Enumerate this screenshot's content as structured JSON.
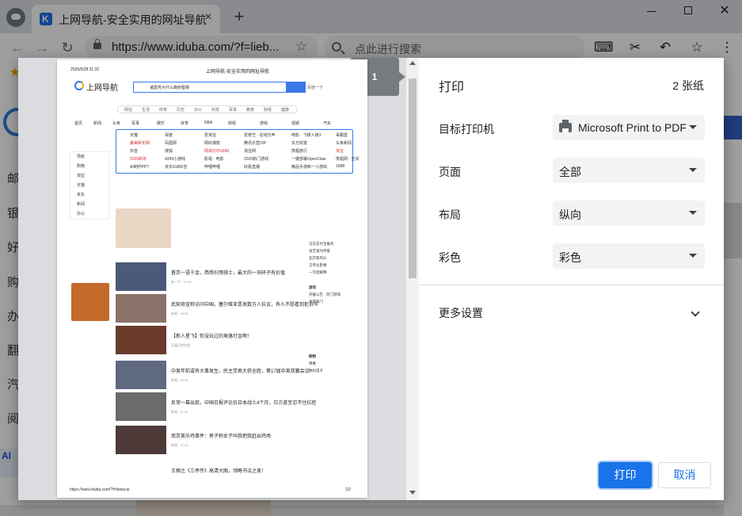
{
  "browser": {
    "tab_title": "上网导航-安全实用的网址导航",
    "url": "https://www.iduba.com/?f=lieb...",
    "search_placeholder": "点此进行搜索",
    "new_tab": "+",
    "close_tab": "×",
    "win_close": "✕",
    "icons": {
      "back": "←",
      "forward": "→",
      "reload": "↻",
      "star": "☆",
      "game": "⌨",
      "cut": "✂",
      "undo": "↶",
      "menu": "⋮"
    }
  },
  "background_page": {
    "left_items": [
      "邮",
      "银",
      "好",
      "购",
      "办",
      "翻",
      "汽",
      "阅"
    ],
    "ai_label": "AI"
  },
  "print_dialog": {
    "title": "打印",
    "sheet_count": "2 张纸",
    "page_badge": "1",
    "settings": [
      {
        "label": "目标打印机",
        "value": "Microsoft Print to PDF"
      },
      {
        "label": "页面",
        "value": "全部"
      },
      {
        "label": "布局",
        "value": "纵向"
      },
      {
        "label": "彩色",
        "value": "彩色"
      }
    ],
    "more_settings": "更多设置",
    "print_button": "打印",
    "cancel_button": "取消"
  },
  "preview_page": {
    "date": "2026/5/28 21:32",
    "header_title": "上网导航-安全实用的网址导航",
    "brand": "上网导航",
    "search_text": "诸葛亮为什么跪到蜀相",
    "search_hint": "百度一下",
    "nav_tabs": [
      "网址",
      "生活",
      "体育",
      "历史",
      "办公",
      "科技",
      "军事",
      "教育",
      "财经",
      "健康"
    ],
    "links_row": [
      "首页",
      "新闻",
      "头条",
      "军事",
      "娱乐",
      "体育",
      "NBA",
      "财经",
      "游戏",
      "视频",
      "汽车"
    ],
    "site_rows": [
      [
        "天猫",
        "百度",
        "爱淘宝",
        "爱奇艺 · 在线乐声",
        "电影 · 飞镖入夜3",
        "毒霸盒"
      ],
      [
        "聚美新年网",
        "凤凰网",
        "网红爆款",
        "腾讯乐营VIP",
        "东方财富",
        "头条新闻"
      ],
      [
        "抖音",
        "搜狐",
        "网易打印1688",
        "淘宝网",
        "携程旅行",
        "淘宝"
      ],
      [
        "2026新年",
        "4399小游戏",
        "影视 · 电影",
        "2026新门游戏",
        "一键部署OpenClaw",
        "携程网 · 空间"
      ],
      [
        "AI制作PPT",
        "京东618红包",
        "哔哩哔哩",
        "好看直播",
        "精品手游新一小游戏",
        "1688"
      ]
    ],
    "side_items": [
      "导航",
      "购物",
      "淘宝",
      "天猫",
      "京东",
      "新闻",
      "办公"
    ],
    "news": [
      {
        "title": "普京一语千金，西南扫荡骑士，最大的一块碎子有价值",
        "meta": "新一手 · 09:38"
      },
      {
        "title": "武契奇宣称访问中国，塞尔维亚是发数万人抗议，有人不愿看到拒诉华",
        "meta": "新闻 · 08:53"
      },
      {
        "title": "【新人星飞】你没玩过的角落打金啊！",
        "meta": "石器天堂特卖"
      },
      {
        "title": "中美年前或有大事发生，民主党君大获全胜，第17届中美双赢会议",
        "meta": "新闻 · 09:55"
      },
      {
        "title": "反常一幕出现，中国日报评论抗日本战土4个月，日方甚至忍不住抗拒",
        "meta": "新闻 · 11:23"
      },
      {
        "title": "南京美乐鸡事件：男子称女子叫我把我赶出鸡场",
        "meta": "新闻 · 17:18"
      },
      {
        "title": "王楠之《三亭传》高清大图，领略书法之美！",
        "meta": ""
      }
    ],
    "right_col": [
      "马云支付宝服务",
      "张艺谋为传家",
      "北京和风头",
      "王传炎影楼",
      "一句话解释",
      "游戏",
      "开服公告 · 热门游戏",
      "手游热门",
      "购物",
      "特惠",
      "数码电子"
    ],
    "footer_url": "https://www.iduba.com/?f=liebacai",
    "footer_page": "1/2"
  }
}
